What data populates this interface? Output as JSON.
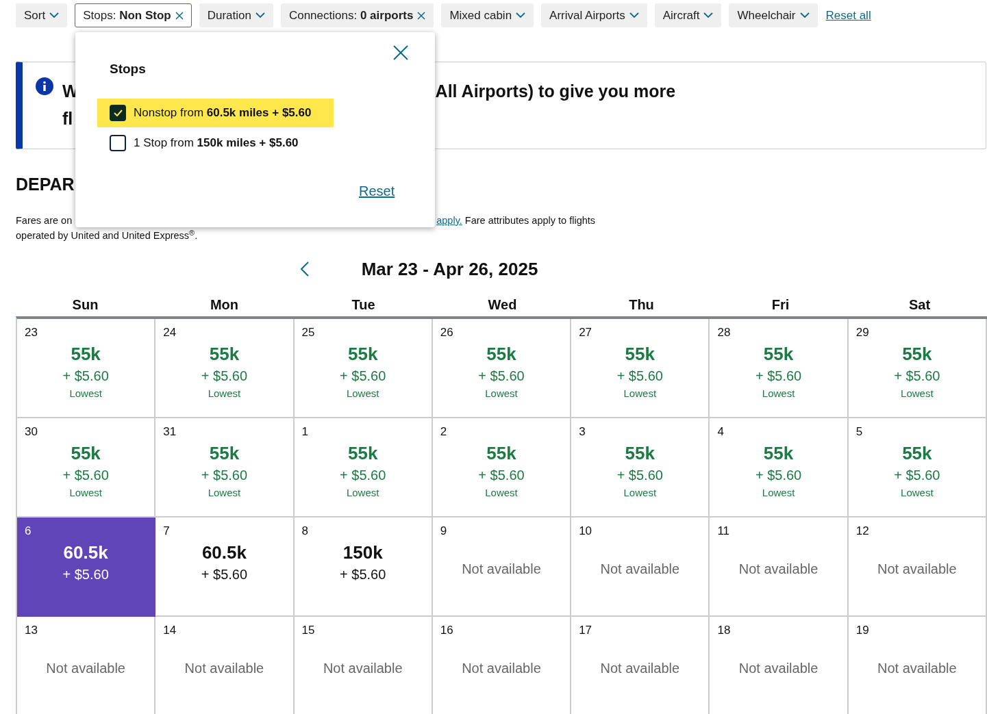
{
  "filters": [
    {
      "kind": "dropdown",
      "label": "Sort",
      "selected": false
    },
    {
      "kind": "applied",
      "label": "Stops:",
      "value": "Non Stop",
      "selected": true
    },
    {
      "kind": "dropdown",
      "label": "Duration",
      "selected": false
    },
    {
      "kind": "applied",
      "label": "Connections:",
      "value": "0 airports",
      "selected": false
    },
    {
      "kind": "dropdown",
      "label": "Mixed cabin",
      "selected": false
    },
    {
      "kind": "dropdown",
      "label": "Arrival Airports",
      "selected": false
    },
    {
      "kind": "dropdown",
      "label": "Aircraft",
      "selected": false
    },
    {
      "kind": "dropdown",
      "label": "Wheelchair",
      "selected": false
    }
  ],
  "reset_all": "Reset all",
  "banner": {
    "line_1_start": "W",
    "line_1_end": "All Airports) to give you more",
    "line_2_start": "fl"
  },
  "heading": "DEPAR",
  "fares_note": {
    "start": "Fares are on",
    "link": "apply.",
    "end": "Fare attributes apply to flights",
    "line_2": "operated by United and United Express$^{®}$."
  },
  "stops_popup": {
    "title": "Stops",
    "options": [
      {
        "text": "Nonstop from **60.5k miles + $5.60**",
        "checked": true
      },
      {
        "text": "1 Stop from **150k miles + $5.60**",
        "checked": false
      }
    ],
    "reset": "Reset"
  },
  "calendar": {
    "title": "Mar 23 - Apr 26, 2025",
    "weekdays": [
      "Sun",
      "Mon",
      "Tue",
      "Wed",
      "Thu",
      "Fri",
      "Sat"
    ],
    "days": [
      {
        "date": "23",
        "kind": "lowest",
        "miles": "55k",
        "fees": "+ $5.60",
        "note": "Lowest",
        "selected": false
      },
      {
        "date": "24",
        "kind": "lowest",
        "miles": "55k",
        "fees": "+ $5.60",
        "note": "Lowest",
        "selected": false
      },
      {
        "date": "25",
        "kind": "lowest",
        "miles": "55k",
        "fees": "+ $5.60",
        "note": "Lowest",
        "selected": false
      },
      {
        "date": "26",
        "kind": "lowest",
        "miles": "55k",
        "fees": "+ $5.60",
        "note": "Lowest",
        "selected": false
      },
      {
        "date": "27",
        "kind": "lowest",
        "miles": "55k",
        "fees": "+ $5.60",
        "note": "Lowest",
        "selected": false
      },
      {
        "date": "28",
        "kind": "lowest",
        "miles": "55k",
        "fees": "+ $5.60",
        "note": "Lowest",
        "selected": false
      },
      {
        "date": "29",
        "kind": "lowest",
        "miles": "55k",
        "fees": "+ $5.60",
        "note": "Lowest",
        "selected": false
      },
      {
        "date": "30",
        "kind": "lowest",
        "miles": "55k",
        "fees": "+ $5.60",
        "note": "Lowest",
        "selected": false
      },
      {
        "date": "31",
        "kind": "lowest",
        "miles": "55k",
        "fees": "+ $5.60",
        "note": "Lowest",
        "selected": false
      },
      {
        "date": "1",
        "kind": "lowest",
        "miles": "55k",
        "fees": "+ $5.60",
        "note": "Lowest",
        "selected": false
      },
      {
        "date": "2",
        "kind": "lowest",
        "miles": "55k",
        "fees": "+ $5.60",
        "note": "Lowest",
        "selected": false
      },
      {
        "date": "3",
        "kind": "lowest",
        "miles": "55k",
        "fees": "+ $5.60",
        "note": "Lowest",
        "selected": false
      },
      {
        "date": "4",
        "kind": "lowest",
        "miles": "55k",
        "fees": "+ $5.60",
        "note": "Lowest",
        "selected": false
      },
      {
        "date": "5",
        "kind": "lowest",
        "miles": "55k",
        "fees": "+ $5.60",
        "note": "Lowest",
        "selected": false
      },
      {
        "date": "6",
        "kind": "fare",
        "miles": "60.5k",
        "fees": "+ $5.60",
        "selected": true
      },
      {
        "date": "7",
        "kind": "fare",
        "miles": "60.5k",
        "fees": "+ $5.60",
        "selected": false
      },
      {
        "date": "8",
        "kind": "fare",
        "miles": "150k",
        "fees": "+ $5.60",
        "selected": false
      },
      {
        "date": "9",
        "kind": "unavailable",
        "note": "Not available",
        "selected": false
      },
      {
        "date": "10",
        "kind": "unavailable",
        "note": "Not available",
        "selected": false
      },
      {
        "date": "11",
        "kind": "unavailable",
        "note": "Not available",
        "selected": false
      },
      {
        "date": "12",
        "kind": "unavailable",
        "note": "Not available",
        "selected": false
      },
      {
        "date": "13",
        "kind": "unavailable",
        "note": "Not available",
        "selected": false
      },
      {
        "date": "14",
        "kind": "unavailable",
        "note": "Not available",
        "selected": false
      },
      {
        "date": "15",
        "kind": "unavailable",
        "note": "Not available",
        "selected": false
      },
      {
        "date": "16",
        "kind": "unavailable",
        "note": "Not available",
        "selected": false
      },
      {
        "date": "17",
        "kind": "unavailable",
        "note": "Not available",
        "selected": false
      },
      {
        "date": "18",
        "kind": "unavailable",
        "note": "Not available",
        "selected": false
      },
      {
        "date": "19",
        "kind": "unavailable",
        "note": "Not available",
        "selected": false
      }
    ]
  }
}
